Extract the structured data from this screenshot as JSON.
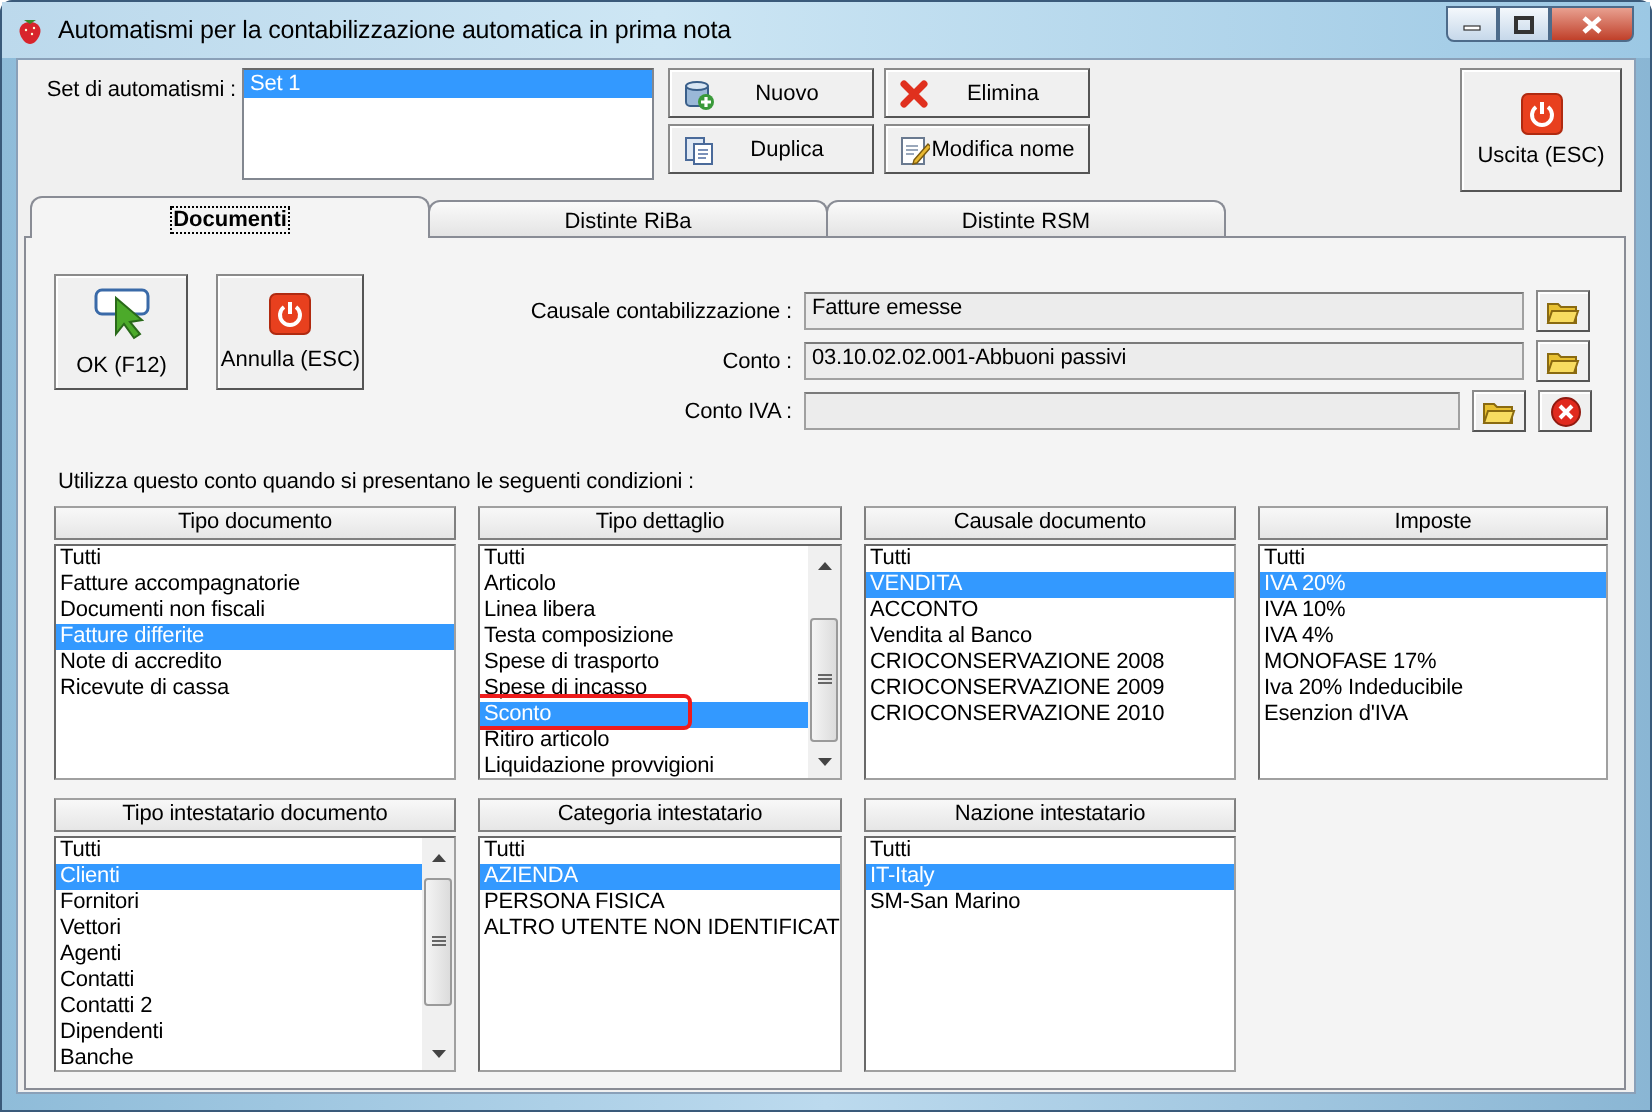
{
  "window": {
    "title": "Automatismi per la contabilizzazione automatica in prima nota"
  },
  "set": {
    "label": "Set di automatismi :",
    "items": [
      {
        "label": "Set 1",
        "selected": true
      }
    ]
  },
  "toolbar": [
    {
      "label": "Nuovo",
      "kind": "new"
    },
    {
      "label": "Elimina",
      "kind": "delete"
    },
    {
      "label": "Duplica",
      "kind": "copy"
    },
    {
      "label": "Modifica nome",
      "kind": "rename"
    }
  ],
  "exit_button": {
    "label": "Uscita (ESC)"
  },
  "tabs": [
    {
      "label": "Documenti",
      "selected": true
    },
    {
      "label": "Distinte RiBa",
      "selected": false
    },
    {
      "label": "Distinte RSM",
      "selected": false
    }
  ],
  "actions": [
    {
      "label": "OK (F12)",
      "kind": "ok"
    },
    {
      "label": "Annulla (ESC)",
      "kind": "cancel"
    }
  ],
  "fields": [
    {
      "label": "Causale contabilizzazione :",
      "value": "Fatture emesse",
      "clearable": false
    },
    {
      "label": "Conto :",
      "value": "03.10.02.02.001-Abbuoni passivi",
      "clearable": false
    },
    {
      "label": "Conto IVA :",
      "clearable": true
    }
  ],
  "instruction": "Utilizza questo conto quando si presentano le seguenti condizioni :",
  "lists": [
    {
      "header": "Tipo documento",
      "scrollable": false,
      "items": [
        {
          "label": "Tutti",
          "selected": false
        },
        {
          "label": "Fatture accompagnatorie",
          "selected": false
        },
        {
          "label": "Documenti non fiscali",
          "selected": false
        },
        {
          "label": "Fatture differite",
          "selected": true
        },
        {
          "label": "Note di accredito",
          "selected": false
        },
        {
          "label": "Ricevute di cassa",
          "selected": false
        }
      ]
    },
    {
      "header": "Tipo dettaglio",
      "scrollable": true,
      "items": [
        {
          "label": "Tutti",
          "selected": false,
          "circled": false
        },
        {
          "label": "Articolo",
          "selected": false,
          "circled": false
        },
        {
          "label": "Linea libera",
          "selected": false,
          "circled": false
        },
        {
          "label": "Testa composizione",
          "selected": false,
          "circled": false
        },
        {
          "label": "Spese di trasporto",
          "selected": false,
          "circled": false
        },
        {
          "label": "Spese di incasso",
          "selected": false,
          "circled": false
        },
        {
          "label": "Sconto",
          "selected": true,
          "circled": true
        },
        {
          "label": "Ritiro articolo",
          "selected": false,
          "circled": false
        },
        {
          "label": "Liquidazione provvigioni",
          "selected": false,
          "circled": false
        }
      ]
    },
    {
      "header": "Causale documento",
      "scrollable": false,
      "items": [
        {
          "label": "Tutti",
          "selected": false
        },
        {
          "label": "VENDITA",
          "selected": true
        },
        {
          "label": "ACCONTO",
          "selected": false
        },
        {
          "label": "Vendita al Banco",
          "selected": false
        },
        {
          "label": "CRIOCONSERVAZIONE 2008",
          "selected": false
        },
        {
          "label": "CRIOCONSERVAZIONE 2009",
          "selected": false
        },
        {
          "label": "CRIOCONSERVAZIONE 2010",
          "selected": false
        }
      ]
    },
    {
      "header": "Imposte",
      "scrollable": false,
      "items": [
        {
          "label": "Tutti",
          "selected": false
        },
        {
          "label": "IVA 20%",
          "selected": true
        },
        {
          "label": "IVA 10%",
          "selected": false
        },
        {
          "label": "IVA 4%",
          "selected": false
        },
        {
          "label": "MONOFASE 17%",
          "selected": false
        },
        {
          "label": "Iva 20% Indeducibile",
          "selected": false
        },
        {
          "label": "Esenzion d'IVA",
          "selected": false
        }
      ]
    },
    {
      "header": "Tipo intestatario documento",
      "scrollable": true,
      "items": [
        {
          "label": "Tutti",
          "selected": false
        },
        {
          "label": "Clienti",
          "selected": true
        },
        {
          "label": "Fornitori",
          "selected": false
        },
        {
          "label": "Vettori",
          "selected": false
        },
        {
          "label": "Agenti",
          "selected": false
        },
        {
          "label": "Contatti",
          "selected": false
        },
        {
          "label": "Contatti 2",
          "selected": false
        },
        {
          "label": "Dipendenti",
          "selected": false
        },
        {
          "label": "Banche",
          "selected": false
        }
      ]
    },
    {
      "header": "Categoria intestatario",
      "scrollable": false,
      "items": [
        {
          "label": "Tutti",
          "selected": false
        },
        {
          "label": "AZIENDA",
          "selected": true
        },
        {
          "label": "PERSONA FISICA",
          "selected": false
        },
        {
          "label": "ALTRO UTENTE NON IDENTIFICAT",
          "selected": false
        }
      ]
    },
    {
      "header": "Nazione intestatario",
      "scrollable": false,
      "items": [
        {
          "label": "Tutti",
          "selected": false
        },
        {
          "label": "IT-Italy",
          "selected": true
        },
        {
          "label": "SM-San Marino",
          "selected": false
        }
      ]
    }
  ]
}
